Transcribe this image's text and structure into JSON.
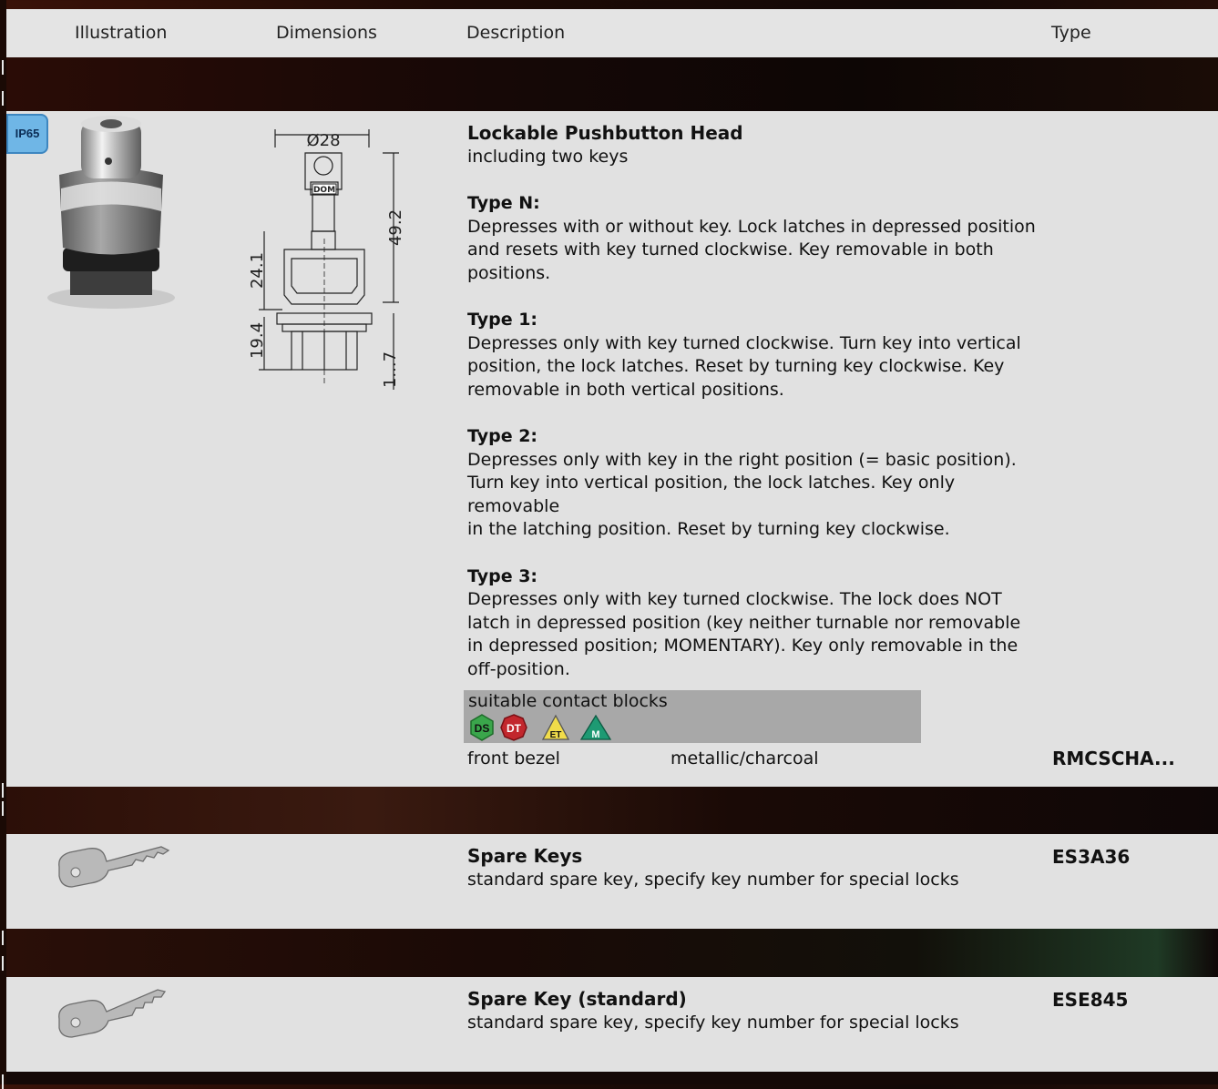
{
  "header": {
    "illustration": "Illustration",
    "dimensions": "Dimensions",
    "description": "Description",
    "type": "Type"
  },
  "main_item": {
    "badge": "IP65",
    "dimensions": {
      "diameter": "Ø28",
      "key_brand": "DOM",
      "height_total": "49.2",
      "height_upper": "24.1",
      "height_lower": "19.4",
      "panel_range": "1...7"
    },
    "title": "Lockable Pushbutton Head",
    "subtitle": "including two keys",
    "types": [
      {
        "heading": "Type N:",
        "text": "Depresses with or without key. Lock latches in depressed position\nand resets with key turned clockwise. Key removable in both\npositions."
      },
      {
        "heading": "Type 1:",
        "text": "Depresses only with key turned clockwise. Turn key into vertical\nposition, the lock latches. Reset by turning key clockwise. Key\nremovable in both vertical positions."
      },
      {
        "heading": "Type 2:",
        "text": "Depresses only with key in the right position (= basic position).\nTurn key into vertical position, the lock latches. Key only removable\nin the latching position. Reset by turning key clockwise."
      },
      {
        "heading": "Type 3:",
        "text": "Depresses only with key turned clockwise. The lock does NOT\nlatch in depressed position (key neither turnable nor removable\nin depressed position; MOMENTARY). Key only removable in the\noff-position."
      }
    ],
    "contact_blocks": {
      "label": "suitable contact blocks",
      "icons": [
        "DS",
        "DT",
        "ET",
        "M"
      ],
      "colors": [
        "#3aa64b",
        "#c2272d",
        "#f1dc4a",
        "#1e9a73"
      ]
    },
    "bezel": {
      "label": "front bezel",
      "finish": "metallic/charcoal",
      "type_code": "RMCSCHA..."
    }
  },
  "spare_keys": [
    {
      "title": "Spare Keys",
      "description": "standard spare key, specify key number for special locks",
      "type_code": "ES3A36"
    },
    {
      "title": "Spare Key (standard)",
      "description": "standard spare key, specify key number for special locks",
      "type_code": "ESE845"
    }
  ]
}
